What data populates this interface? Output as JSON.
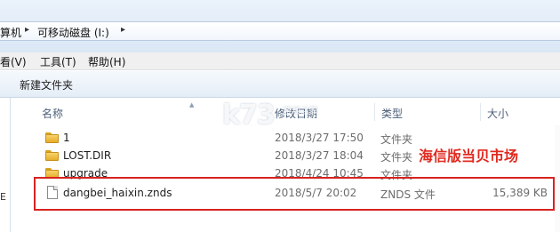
{
  "address": {
    "crumbs": [
      "算机",
      "可移动磁盘 (I:)"
    ]
  },
  "menu": {
    "items": [
      "看(V)",
      "工具(T)",
      "帮助(H)"
    ]
  },
  "toolbar": {
    "new_folder": "新建文件夹"
  },
  "left_pane_char": "E",
  "columns": {
    "name": "名称",
    "date": "修改日期",
    "type": "类型",
    "size": "大小"
  },
  "files": [
    {
      "name": "1",
      "date": "2018/3/27 17:50",
      "type": "文件夹",
      "size": "",
      "icon": "folder-icon"
    },
    {
      "name": "LOST.DIR",
      "date": "2018/3/27 18:04",
      "type": "文件夹",
      "size": "",
      "icon": "folder-icon"
    },
    {
      "name": "upgrade",
      "date": "2018/4/24 10:45",
      "type": "文件夹",
      "size": "",
      "icon": "folder-icon"
    },
    {
      "name": "dangbei_haixin.znds",
      "date": "2018/5/7 20:02",
      "type": "ZNDS 文件",
      "size": "15,389 KB",
      "icon": "file-icon"
    }
  ],
  "annotation": "海信版当贝市场",
  "watermark": {
    "logo": "k73",
    "sub": "游戏之家"
  },
  "colors": {
    "highlight": "#d8231f",
    "annotation": "#e02a20",
    "header_text": "#4c607a"
  }
}
